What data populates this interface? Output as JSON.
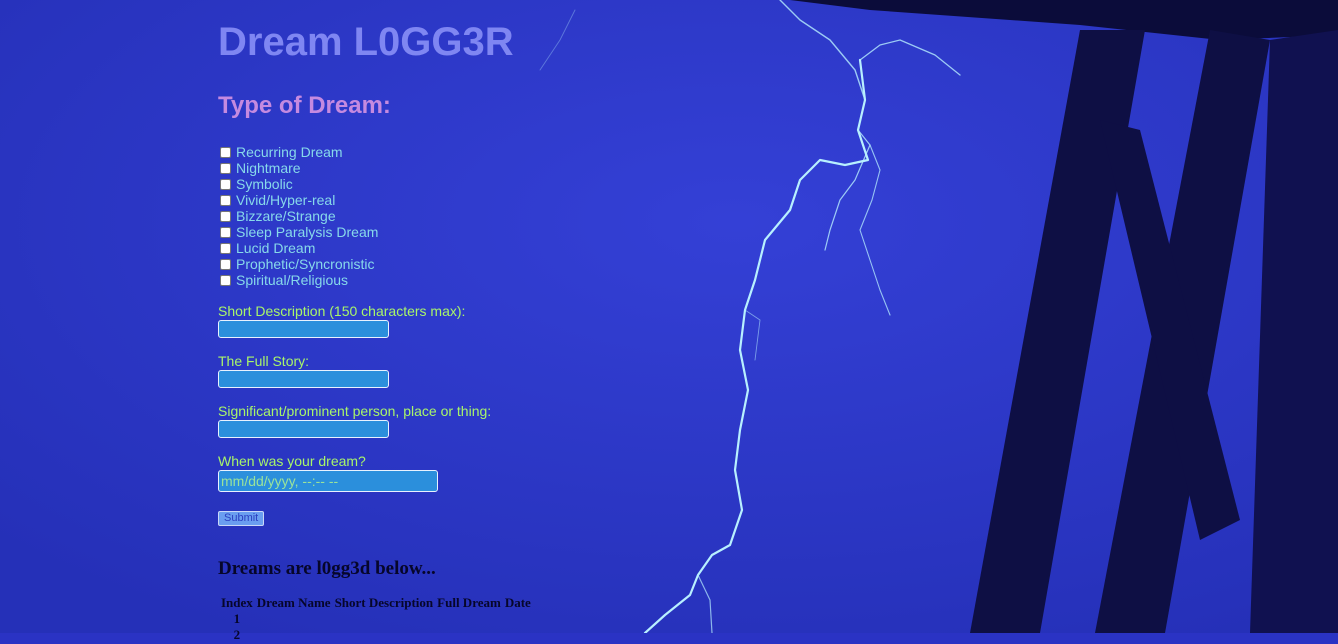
{
  "header": {
    "title": "Dream L0GG3R"
  },
  "form": {
    "type_heading": "Type of Dream:",
    "dream_types": [
      "Recurring Dream",
      "Nightmare",
      "Symbolic",
      "Vivid/Hyper-real",
      "Bizzare/Strange",
      "Sleep Paralysis Dream",
      "Lucid Dream",
      "Prophetic/Syncronistic",
      "Spiritual/Religious"
    ],
    "short_description_label": "Short Description (150 characters max):",
    "short_description_value": "",
    "full_story_label": "The Full Story:",
    "full_story_value": "",
    "significant_label": "Significant/prominent person, place or thing:",
    "significant_value": "",
    "date_label": "When was your dream?",
    "date_placeholder": "mm/dd/yyyy, --:-- --",
    "submit_label": "Submit"
  },
  "log": {
    "heading": "Dreams are l0gg3d below...",
    "columns": [
      "Index",
      "Dream Name",
      "Short Description",
      "Full Dream",
      "Date"
    ],
    "rows": [
      {
        "index": "1"
      },
      {
        "index": "2"
      }
    ]
  },
  "theme": {
    "background": "#2a33c4",
    "title_color": "#7f86f2",
    "subtitle_color": "#c58ae0",
    "checkbox_label_color": "#87d9ea",
    "field_label_color": "#a8f56a",
    "input_fill": "#2b8fdc"
  }
}
